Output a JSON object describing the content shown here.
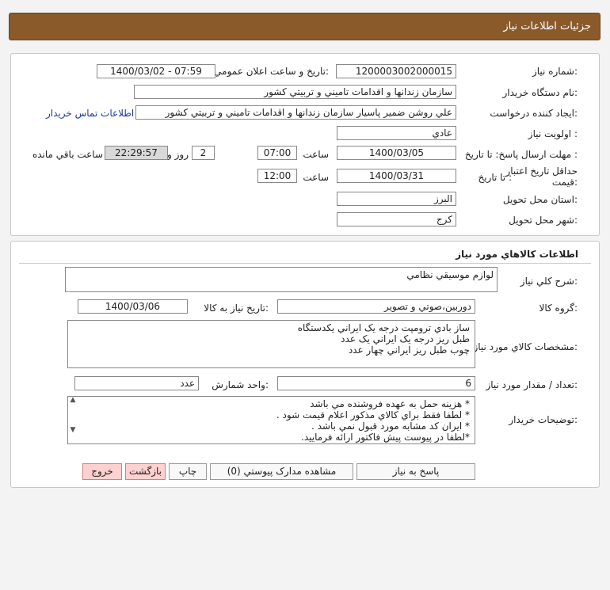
{
  "header": {
    "title": "جزئيات اطلاعات نياز"
  },
  "info": {
    "need_number_label": "شماره نياز:",
    "need_number": "1200003002000015",
    "announce_label": "تاريخ و ساعت اعلان عمومي:",
    "announce_value": "1400/03/02 - 07:59",
    "buyer_label": "نام دستگاه خريدار:",
    "buyer_value": "سازمان زندانها و اقدامات تاميني و تربيتي کشور",
    "creator_label": "ايجاد کننده درخواست:",
    "creator_value": "علي روشن ضمير پاسيار سازمان زندانها و اقدامات تاميني و تربيتي کشور",
    "contact_link": "اطلاعات تماس خريدار",
    "priority_label": "اولويت نياز :",
    "priority_value": "عادي",
    "send_deadline_label": "مهلت ارسال پاسخ: تا تاريخ :",
    "send_date": "1400/03/05",
    "time_label": "ساعت",
    "send_time": "07:00",
    "days_value": "2",
    "days_label": "روز و",
    "remaining_time": "22:29:57",
    "remaining_label": "ساعت باقي مانده",
    "validity_label_1": "حداقل تاريخ اعتبار",
    "validity_label_2": "قيمت:",
    "until_label": "تا تاريخ :",
    "validity_date": "1400/03/31",
    "validity_time": "12:00",
    "province_label": "استان محل تحويل:",
    "province_value": "البرز",
    "city_label": "شهر محل تحويل:",
    "city_value": "کرج"
  },
  "goods": {
    "section_title": "اطلاعات کالاهاي مورد نياز",
    "summary_label": "شرح کلي نياز:",
    "summary_value": "لوازم موسيقي نظامي",
    "group_label": "گروه کالا:",
    "group_value": "دوربين،صوتي و تصوير",
    "need_date_label": "تاريخ نياز به کالا:",
    "need_date": "1400/03/06",
    "specs_label": "مشخصات کالاي مورد نياز:",
    "specs_lines": [
      "ساز بادي ترومپت درجه يک ايراني يکدستگاه",
      "طبل ريز درجه يک ايراني يک عدد",
      "چوب طبل ريز ايراني چهار عدد"
    ],
    "qty_label": "تعداد / مقدار مورد نياز:",
    "qty_value": "6",
    "unit_label": "واحد شمارش:",
    "unit_value": "عدد",
    "notes_label": "توضيحات خريدار:",
    "notes_lines": [
      "هزينه حمل به عهده فروشنده مي باشد *",
      ". لطفا فقط براي کالاي مذکور اعلام قيمت شود *",
      ". ايران کد مشابه مورد قبول نمي باشد *",
      ".لطفا در پيوست پيش فاکتور ارائه فرماييد*"
    ]
  },
  "buttons": {
    "reply": "پاسخ به نياز",
    "attachments": "مشاهده مدارک پيوستي (0)",
    "print": "چاپ",
    "back": "بازگشت",
    "exit": "خروج"
  }
}
